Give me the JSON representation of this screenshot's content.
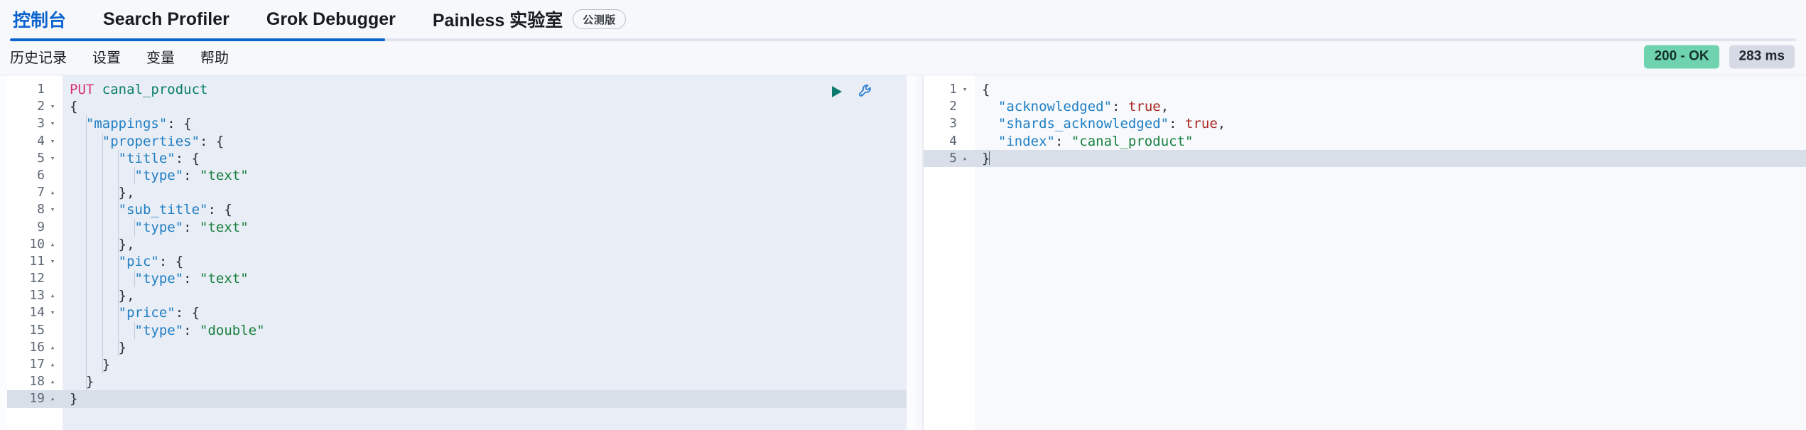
{
  "header": {
    "tabs": [
      {
        "label": "控制台",
        "active": true,
        "badge": null
      },
      {
        "label": "Search Profiler",
        "active": false,
        "badge": null
      },
      {
        "label": "Grok Debugger",
        "active": false,
        "badge": null
      },
      {
        "label": "Painless 实验室",
        "active": false,
        "badge": "公测版"
      }
    ]
  },
  "subbar": {
    "nav": [
      {
        "label": "历史记录"
      },
      {
        "label": "设置"
      },
      {
        "label": "变量"
      },
      {
        "label": "帮助"
      }
    ],
    "status": {
      "code_label": "200 - OK",
      "time_label": "283 ms",
      "ok_color": "#6fd3b0",
      "time_color": "#d6dae4"
    },
    "progress_percent": 21
  },
  "request_editor": {
    "name": "console-request-editor",
    "actions": [
      {
        "icon": "play-icon",
        "label": "发送请求",
        "color": "#0c7b6e"
      },
      {
        "icon": "wrench-icon",
        "label": "扳手菜单",
        "color": "#2f7fd1"
      }
    ],
    "highlight_line": 19,
    "lines": [
      {
        "n": 1,
        "fold": "",
        "tokens": [
          {
            "t": "method",
            "v": "PUT"
          },
          {
            "t": "punc",
            "v": " "
          },
          {
            "t": "url",
            "v": "canal_product"
          }
        ]
      },
      {
        "n": 2,
        "fold": "down",
        "tokens": [
          {
            "t": "punc",
            "v": "{"
          }
        ]
      },
      {
        "n": 3,
        "fold": "down",
        "tokens": [
          {
            "t": "punc",
            "v": "  "
          },
          {
            "t": "key",
            "v": "\"mappings\""
          },
          {
            "t": "punc",
            "v": ": {"
          }
        ]
      },
      {
        "n": 4,
        "fold": "down",
        "tokens": [
          {
            "t": "punc",
            "v": "    "
          },
          {
            "t": "key",
            "v": "\"properties\""
          },
          {
            "t": "punc",
            "v": ": {"
          }
        ]
      },
      {
        "n": 5,
        "fold": "down",
        "tokens": [
          {
            "t": "punc",
            "v": "      "
          },
          {
            "t": "key",
            "v": "\"title\""
          },
          {
            "t": "punc",
            "v": ": {"
          }
        ]
      },
      {
        "n": 6,
        "fold": "",
        "tokens": [
          {
            "t": "punc",
            "v": "        "
          },
          {
            "t": "key",
            "v": "\"type\""
          },
          {
            "t": "punc",
            "v": ": "
          },
          {
            "t": "str",
            "v": "\"text\""
          }
        ]
      },
      {
        "n": 7,
        "fold": "up",
        "tokens": [
          {
            "t": "punc",
            "v": "      },"
          }
        ]
      },
      {
        "n": 8,
        "fold": "down",
        "tokens": [
          {
            "t": "punc",
            "v": "      "
          },
          {
            "t": "key",
            "v": "\"sub_title\""
          },
          {
            "t": "punc",
            "v": ": {"
          }
        ]
      },
      {
        "n": 9,
        "fold": "",
        "tokens": [
          {
            "t": "punc",
            "v": "        "
          },
          {
            "t": "key",
            "v": "\"type\""
          },
          {
            "t": "punc",
            "v": ": "
          },
          {
            "t": "str",
            "v": "\"text\""
          }
        ]
      },
      {
        "n": 10,
        "fold": "up",
        "tokens": [
          {
            "t": "punc",
            "v": "      },"
          }
        ]
      },
      {
        "n": 11,
        "fold": "down",
        "tokens": [
          {
            "t": "punc",
            "v": "      "
          },
          {
            "t": "key",
            "v": "\"pic\""
          },
          {
            "t": "punc",
            "v": ": {"
          }
        ]
      },
      {
        "n": 12,
        "fold": "",
        "tokens": [
          {
            "t": "punc",
            "v": "        "
          },
          {
            "t": "key",
            "v": "\"type\""
          },
          {
            "t": "punc",
            "v": ": "
          },
          {
            "t": "str",
            "v": "\"text\""
          }
        ]
      },
      {
        "n": 13,
        "fold": "up",
        "tokens": [
          {
            "t": "punc",
            "v": "      },"
          }
        ]
      },
      {
        "n": 14,
        "fold": "down",
        "tokens": [
          {
            "t": "punc",
            "v": "      "
          },
          {
            "t": "key",
            "v": "\"price\""
          },
          {
            "t": "punc",
            "v": ": {"
          }
        ]
      },
      {
        "n": 15,
        "fold": "",
        "tokens": [
          {
            "t": "punc",
            "v": "        "
          },
          {
            "t": "key",
            "v": "\"type\""
          },
          {
            "t": "punc",
            "v": ": "
          },
          {
            "t": "str",
            "v": "\"double\""
          }
        ]
      },
      {
        "n": 16,
        "fold": "up",
        "tokens": [
          {
            "t": "punc",
            "v": "      }"
          }
        ]
      },
      {
        "n": 17,
        "fold": "up",
        "tokens": [
          {
            "t": "punc",
            "v": "    }"
          }
        ]
      },
      {
        "n": 18,
        "fold": "up",
        "tokens": [
          {
            "t": "punc",
            "v": "  }"
          }
        ]
      },
      {
        "n": 19,
        "fold": "up",
        "tokens": [
          {
            "t": "punc",
            "v": "}"
          }
        ]
      }
    ]
  },
  "response_editor": {
    "name": "console-response-viewer",
    "highlight_line": 5,
    "lines": [
      {
        "n": 1,
        "fold": "down",
        "tokens": [
          {
            "t": "punc",
            "v": "{"
          }
        ]
      },
      {
        "n": 2,
        "fold": "",
        "tokens": [
          {
            "t": "punc",
            "v": "  "
          },
          {
            "t": "key",
            "v": "\"acknowledged\""
          },
          {
            "t": "punc",
            "v": ": "
          },
          {
            "t": "bool",
            "v": "true"
          },
          {
            "t": "punc",
            "v": ","
          }
        ]
      },
      {
        "n": 3,
        "fold": "",
        "tokens": [
          {
            "t": "punc",
            "v": "  "
          },
          {
            "t": "key",
            "v": "\"shards_acknowledged\""
          },
          {
            "t": "punc",
            "v": ": "
          },
          {
            "t": "bool",
            "v": "true"
          },
          {
            "t": "punc",
            "v": ","
          }
        ]
      },
      {
        "n": 4,
        "fold": "",
        "tokens": [
          {
            "t": "punc",
            "v": "  "
          },
          {
            "t": "key",
            "v": "\"index\""
          },
          {
            "t": "punc",
            "v": ": "
          },
          {
            "t": "str",
            "v": "\"canal_product\""
          }
        ]
      },
      {
        "n": 5,
        "fold": "up",
        "tokens": [
          {
            "t": "punc",
            "v": "}"
          }
        ]
      }
    ]
  },
  "colors": {
    "accent": "#0b63ce",
    "method": "#d6336c",
    "url": "#0a7f6c",
    "key": "#1f7fc4",
    "string": "#17803d",
    "boolean": "#a8261e",
    "editor_bg": "#e9edf5",
    "response_bg": "#f7f9fc",
    "highlight": "#d8dfe9"
  }
}
